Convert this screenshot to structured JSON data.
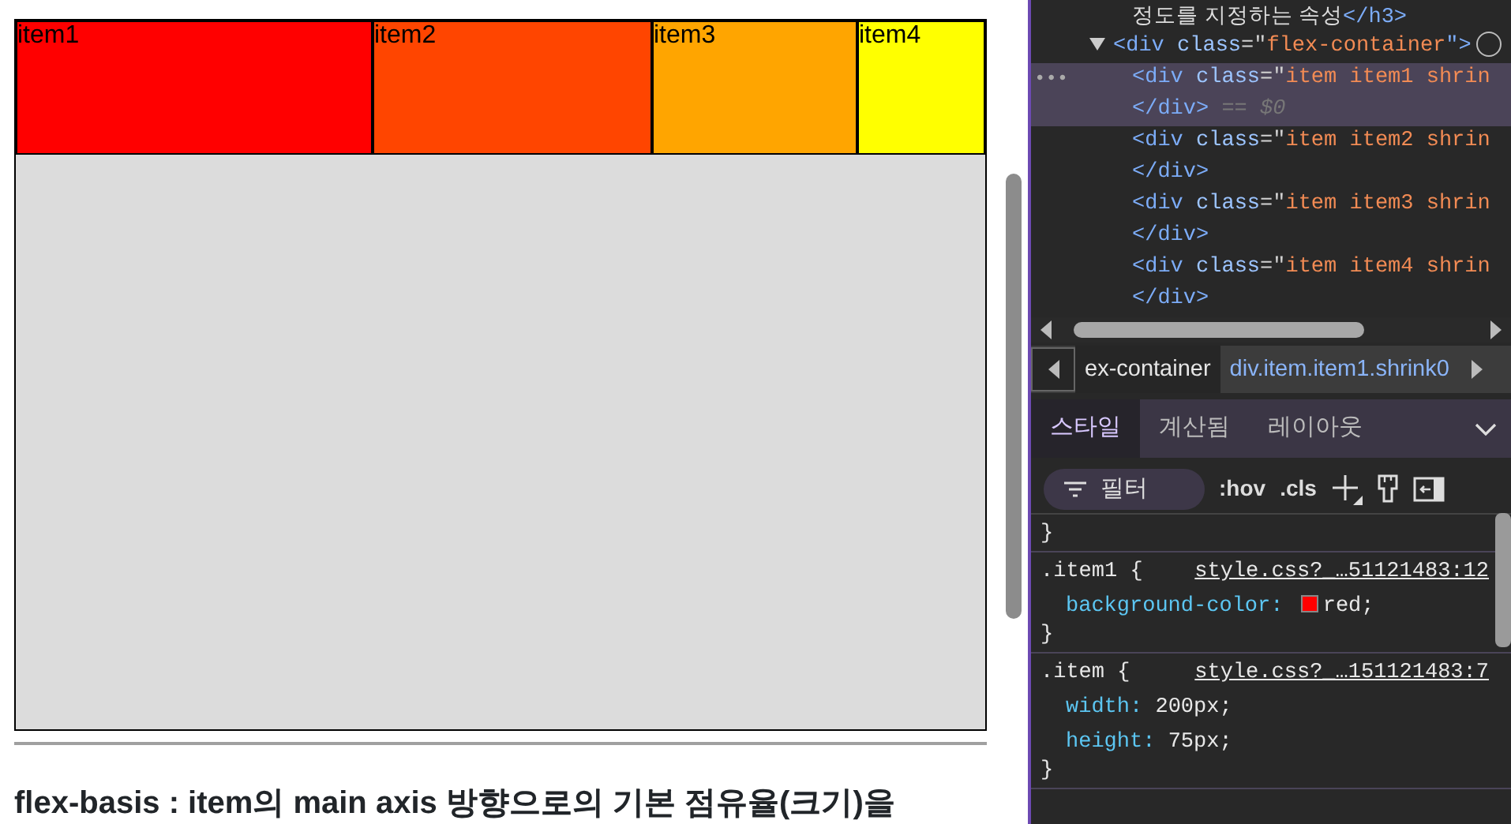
{
  "page": {
    "flex_items": [
      {
        "label": "item1",
        "color": "#ff0000"
      },
      {
        "label": "item2",
        "color": "#ff4500"
      },
      {
        "label": "item3",
        "color": "#ffa500"
      },
      {
        "label": "item4",
        "color": "#ffff00"
      }
    ],
    "heading": "flex-basis : item의 main axis 방향으로의 기본 점유율(크기)을"
  },
  "devtools": {
    "dom_tree": [
      {
        "kind": "text",
        "selected": false,
        "open": [
          {
            "kind": "text",
            "text": "정도를 지정하는 속성"
          },
          {
            "kind": "tag",
            "text": "</h3>"
          }
        ]
      },
      {
        "kind": "element",
        "selected": false,
        "expanded": true,
        "open": [
          {
            "kind": "tag",
            "text": "<div "
          },
          {
            "kind": "attr",
            "text": "class"
          },
          {
            "kind": "punct",
            "text": "=\""
          },
          {
            "kind": "value",
            "text": "flex-container"
          },
          {
            "kind": "tag",
            "text": "\">"
          }
        ],
        "children": [
          {
            "kind": "element",
            "selected": true,
            "gutter_mark": "•••",
            "open": [
              {
                "kind": "tag",
                "text": "<div "
              },
              {
                "kind": "attr",
                "text": "class"
              },
              {
                "kind": "punct",
                "text": "=\""
              },
              {
                "kind": "value",
                "text": "item item1 shrin"
              }
            ],
            "close": [
              {
                "kind": "tag",
                "text": "</div>"
              },
              {
                "kind": "hint",
                "text": " == $0"
              }
            ]
          },
          {
            "kind": "element",
            "selected": false,
            "open": [
              {
                "kind": "tag",
                "text": "<div "
              },
              {
                "kind": "attr",
                "text": "class"
              },
              {
                "kind": "punct",
                "text": "=\""
              },
              {
                "kind": "value",
                "text": "item item2 shrin"
              }
            ],
            "close": [
              {
                "kind": "tag",
                "text": "</div>"
              }
            ]
          },
          {
            "kind": "element",
            "selected": false,
            "open": [
              {
                "kind": "tag",
                "text": "<div "
              },
              {
                "kind": "attr",
                "text": "class"
              },
              {
                "kind": "punct",
                "text": "=\""
              },
              {
                "kind": "value",
                "text": "item item3 shrin"
              }
            ],
            "close": [
              {
                "kind": "tag",
                "text": "</div>"
              }
            ]
          },
          {
            "kind": "element",
            "selected": false,
            "open": [
              {
                "kind": "tag",
                "text": "<div "
              },
              {
                "kind": "attr",
                "text": "class"
              },
              {
                "kind": "punct",
                "text": "=\""
              },
              {
                "kind": "value",
                "text": "item item4 shrin"
              }
            ],
            "close": [
              {
                "kind": "tag",
                "text": "</div>"
              }
            ]
          }
        ]
      }
    ],
    "breadcrumbs": [
      {
        "label": "ex-container",
        "selected": false
      },
      {
        "label": "div.item.item1.shrink0",
        "selected": true
      }
    ],
    "tabs": [
      {
        "label": "스타일",
        "selected": true
      },
      {
        "label": "계산됨",
        "selected": false
      },
      {
        "label": "레이아웃",
        "selected": false
      }
    ],
    "filter": {
      "placeholder": "필터"
    },
    "toolbar_buttons": [
      ":hov",
      ".cls"
    ],
    "styles": {
      "leading_brace": "}",
      "rules": [
        {
          "selector": ".item1 {",
          "source": "style.css?_…51121483:12",
          "declarations": [
            {
              "kind": "color",
              "property": "background-color:",
              "value": "red;"
            }
          ],
          "close": "}"
        },
        {
          "selector": ".item {",
          "source": "style.css?_…151121483:7",
          "declarations": [
            {
              "kind": "plain",
              "property": "width:",
              "value": "200px;"
            },
            {
              "kind": "plain",
              "property": "height:",
              "value": "75px;"
            }
          ],
          "close": "}"
        }
      ]
    }
  }
}
